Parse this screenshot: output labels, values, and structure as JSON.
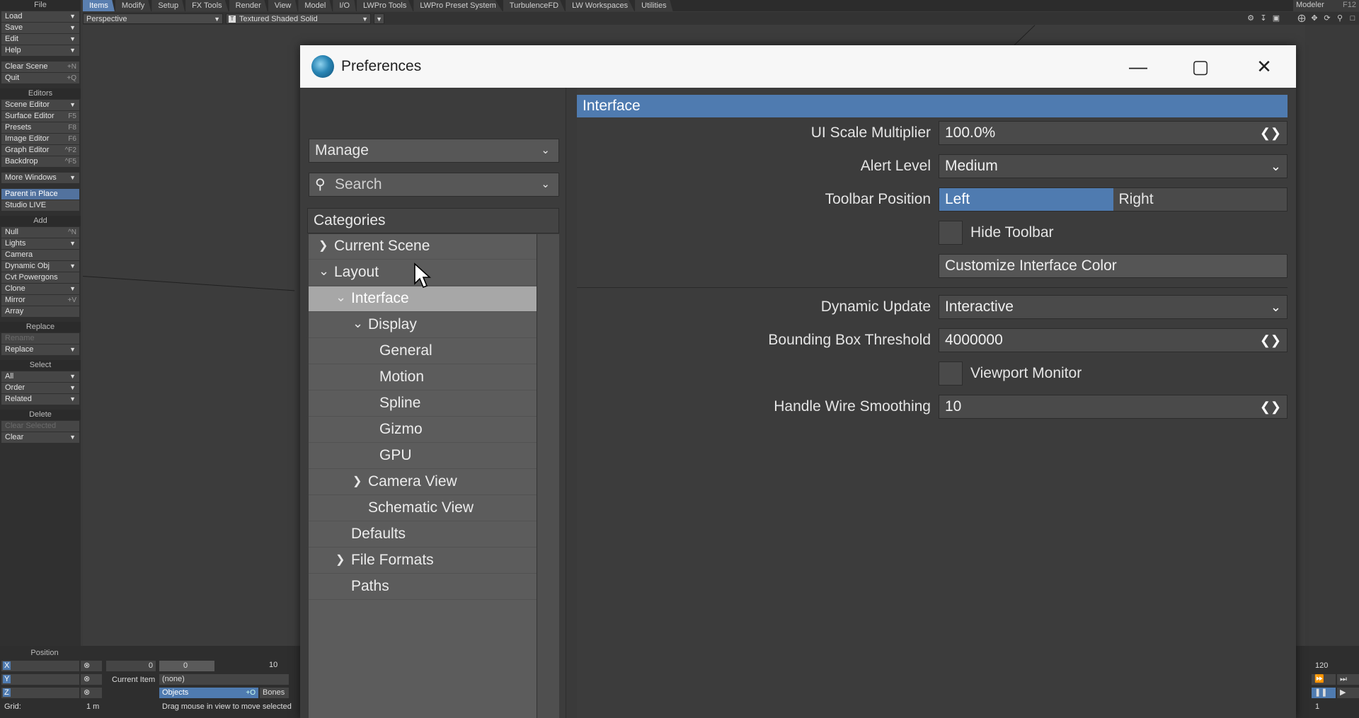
{
  "topbar": {
    "tabs": [
      "Items",
      "Modify",
      "Setup",
      "FX Tools",
      "Render",
      "View",
      "Model",
      "I/O",
      "LWPro Tools",
      "LWPro Preset System",
      "TurbulenceFD",
      "LW Workspaces",
      "Utilities"
    ],
    "modeler": "Modeler",
    "modeler_key": "F12"
  },
  "viewport_header": {
    "view": "Perspective",
    "render_mode": "Textured Shaded Solid"
  },
  "leftbar": {
    "file_header": "File",
    "file": [
      {
        "label": "Load",
        "dd": true
      },
      {
        "label": "Save",
        "dd": true
      },
      {
        "label": "Edit",
        "dd": true
      },
      {
        "label": "Help",
        "dd": true
      }
    ],
    "clear_scene": {
      "label": "Clear Scene",
      "shortcut": "+N"
    },
    "quit": {
      "label": "Quit",
      "shortcut": "+Q"
    },
    "editors_header": "Editors",
    "editors": [
      {
        "label": "Scene Editor",
        "dd": true
      },
      {
        "label": "Surface Editor",
        "shortcut": "F5"
      },
      {
        "label": "Presets",
        "shortcut": "F8"
      },
      {
        "label": "Image Editor",
        "shortcut": "F6"
      },
      {
        "label": "Graph Editor",
        "shortcut": "^F2"
      },
      {
        "label": "Backdrop",
        "shortcut": "^F5"
      }
    ],
    "more_windows": "More Windows",
    "parent_in_place": "Parent in Place",
    "studio_live": "Studio LIVE",
    "add_header": "Add",
    "add": [
      {
        "label": "Null",
        "shortcut": "^N"
      },
      {
        "label": "Lights",
        "dd": true
      },
      {
        "label": "Camera"
      },
      {
        "label": "Dynamic Obj",
        "dd": true
      },
      {
        "label": "Cvt Powergons"
      },
      {
        "label": "Clone",
        "dd": true
      },
      {
        "label": "Mirror",
        "shortcut": "+V"
      },
      {
        "label": "Array"
      }
    ],
    "replace_header": "Replace",
    "rename": "Rename",
    "replace": "Replace",
    "select_header": "Select",
    "select": [
      {
        "label": "All"
      },
      {
        "label": "Order"
      },
      {
        "label": "Related"
      }
    ],
    "delete_header": "Delete",
    "clear_selected": "Clear Selected",
    "clear": "Clear"
  },
  "bottom": {
    "position_label": "Position",
    "axes": [
      "X",
      "Y",
      "Z"
    ],
    "x_value": "0",
    "slider_min": "0",
    "slider_max": "10",
    "current_item_label": "Current Item",
    "current_item_value": "(none)",
    "objects_label": "Objects",
    "objects_shortcut": "+O",
    "bones_label": "Bones",
    "grid_label": "Grid:",
    "grid_value": "1 m",
    "hint": "Drag mouse in view to move selected",
    "frame_end": "120",
    "frame_current": "1"
  },
  "dialog": {
    "title": "Preferences",
    "manage": "Manage",
    "search_placeholder": "Search",
    "categories_header": "Categories",
    "tree": [
      {
        "label": "Current Scene",
        "level": 0,
        "arrow": "right"
      },
      {
        "label": "Layout",
        "level": 0,
        "arrow": "down"
      },
      {
        "label": "Interface",
        "level": 1,
        "arrow": "down",
        "selected": true
      },
      {
        "label": "Display",
        "level": 2,
        "arrow": "down"
      },
      {
        "label": "General",
        "level": 3
      },
      {
        "label": "Motion",
        "level": 3
      },
      {
        "label": "Spline",
        "level": 3
      },
      {
        "label": "Gizmo",
        "level": 3
      },
      {
        "label": "GPU",
        "level": 3
      },
      {
        "label": "Camera View",
        "level": 2,
        "arrow": "right"
      },
      {
        "label": "Schematic View",
        "level": 2
      },
      {
        "label": "Defaults",
        "level": 1
      },
      {
        "label": "File Formats",
        "level": 1,
        "arrow": "right"
      },
      {
        "label": "Paths",
        "level": 1
      }
    ],
    "section": "Interface",
    "ui_scale_label": "UI Scale Multiplier",
    "ui_scale_value": "100.0%",
    "alert_label": "Alert Level",
    "alert_value": "Medium",
    "toolbar_pos_label": "Toolbar Position",
    "toolbar_left": "Left",
    "toolbar_right": "Right",
    "hide_toolbar": "Hide Toolbar",
    "customize_color": "Customize Interface Color",
    "dynamic_update_label": "Dynamic Update",
    "dynamic_update_value": "Interactive",
    "bbox_label": "Bounding Box Threshold",
    "bbox_value": "4000000",
    "viewport_monitor": "Viewport Monitor",
    "handle_wire_label": "Handle Wire Smoothing",
    "handle_wire_value": "10"
  },
  "colors": {
    "accent": "#4f7bb0",
    "selected_tree": "#a7a7a7",
    "background": "#3c3c3c"
  }
}
